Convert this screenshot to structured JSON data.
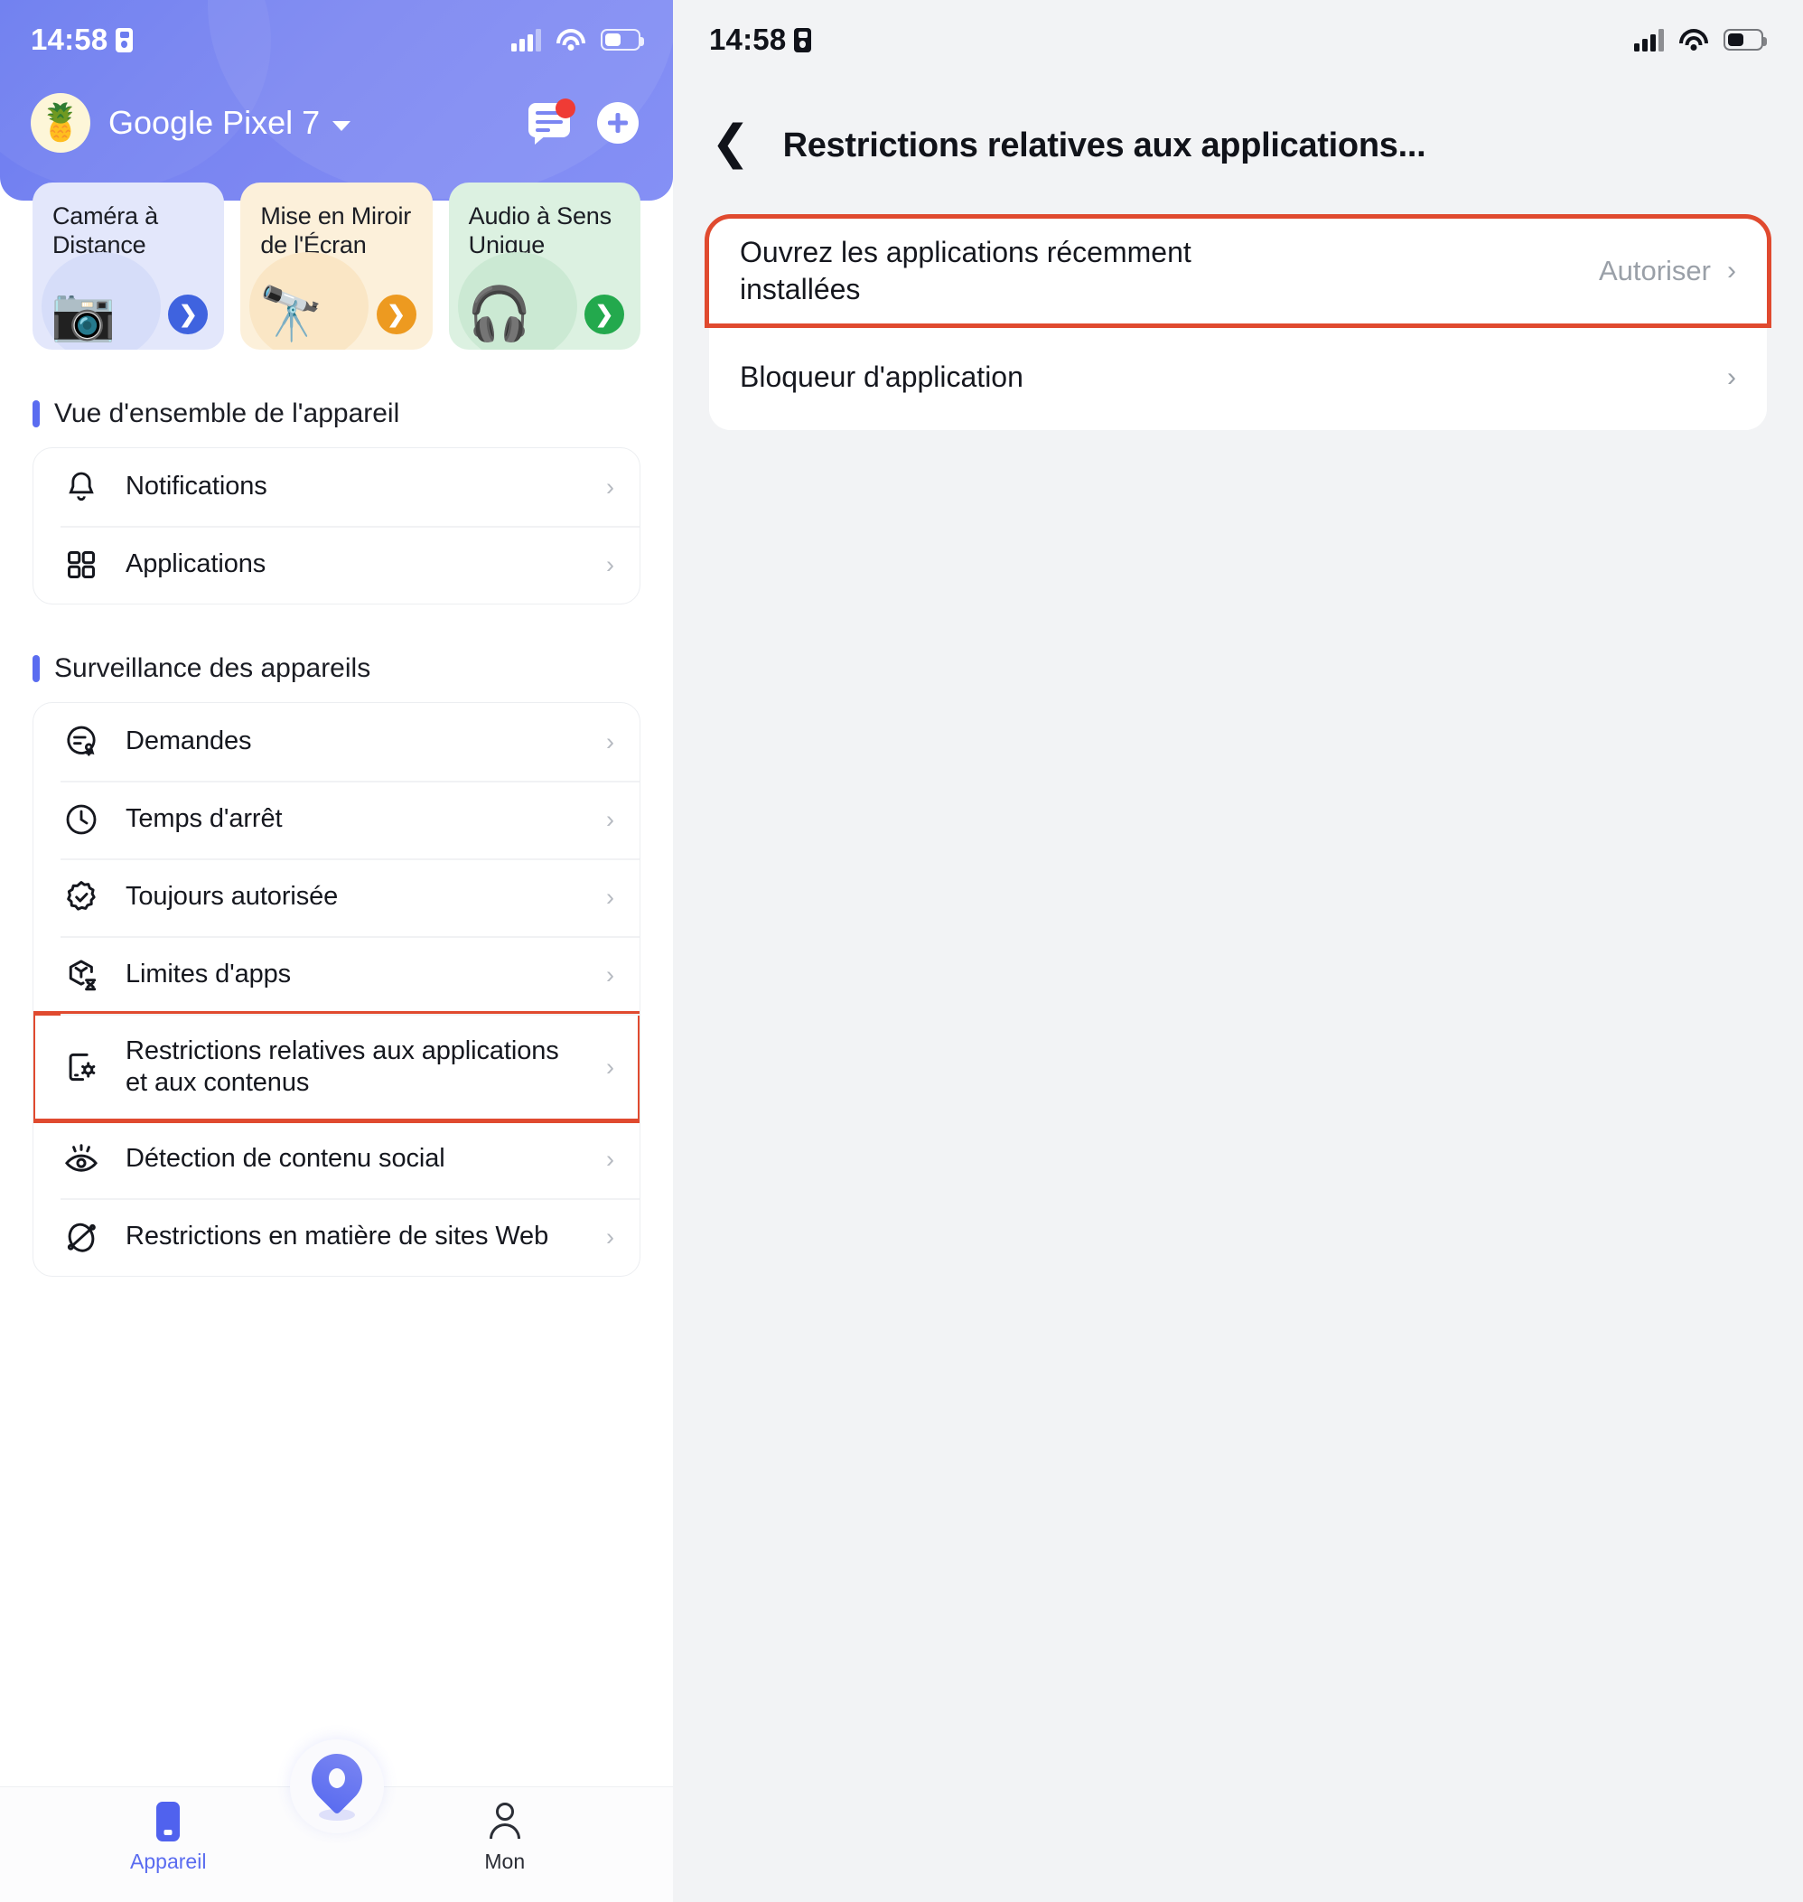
{
  "left": {
    "status": {
      "time": "14:58",
      "sim_icon": "sim-card-icon"
    },
    "header": {
      "avatar_emoji": "🍍",
      "device_name": "Google Pixel 7",
      "dropdown_icon": "caret-down-icon",
      "chat_icon": "message-icon",
      "add_icon": "plus-icon"
    },
    "feature_cards": [
      {
        "title": "Caméra à Distance",
        "glyph": "📷",
        "bg": "#e3e7fb",
        "blob": "#d6ddf9",
        "arrow_color": "#3f63df"
      },
      {
        "title": "Mise en Miroir de l'Écran",
        "glyph": "🔭",
        "bg": "#fcf0da",
        "blob": "#fae6c5",
        "arrow_color": "#ed9a20"
      },
      {
        "title": "Audio à Sens Unique",
        "glyph": "🎧",
        "bg": "#dcf1e1",
        "blob": "#cbe9d3",
        "arrow_color": "#23a94d"
      }
    ],
    "sections": [
      {
        "title": "Vue d'ensemble de l'appareil",
        "items": [
          {
            "label": "Notifications",
            "icon": "bell-icon",
            "chevron": "›"
          },
          {
            "label": "Applications",
            "icon": "grid-apps-icon",
            "chevron": "›"
          }
        ]
      },
      {
        "title": "Surveillance des appareils",
        "items": [
          {
            "label": "Demandes",
            "icon": "request-message-icon",
            "chevron": "›"
          },
          {
            "label": "Temps d'arrêt",
            "icon": "clock-icon",
            "chevron": "›"
          },
          {
            "label": "Toujours autorisée",
            "icon": "badge-check-icon",
            "chevron": "›"
          },
          {
            "label": "Limites d'apps",
            "icon": "hourglass-limit-icon",
            "chevron": "›"
          },
          {
            "label": "Restrictions relatives aux applications et aux contenus",
            "icon": "device-settings-icon",
            "chevron": "›",
            "highlighted": true
          },
          {
            "label": "Détection de contenu social",
            "icon": "eye-detect-icon",
            "chevron": "›"
          },
          {
            "label": "Restrictions en matière de sites Web",
            "icon": "globe-blocked-icon",
            "chevron": "›"
          }
        ]
      }
    ],
    "bottom_nav": {
      "fab_icon": "location-pin-icon",
      "tabs": [
        {
          "label": "Appareil",
          "icon": "phone-icon",
          "active": true
        },
        {
          "label": "Mon",
          "icon": "person-icon",
          "active": false
        }
      ]
    }
  },
  "right": {
    "status": {
      "time": "14:58",
      "sim_icon": "sim-card-icon"
    },
    "header": {
      "back_icon": "back-chevron-icon",
      "title": "Restrictions relatives aux applications..."
    },
    "items": [
      {
        "label": "Ouvrez les applications récemment installées",
        "value": "Autoriser",
        "chevron": "›",
        "highlighted": true
      },
      {
        "label": "Bloqueur d'application",
        "value": "",
        "chevron": "›",
        "highlighted": false
      }
    ]
  },
  "colors": {
    "accent_blue": "#5a6cf0",
    "highlight_red": "#e04a2f",
    "muted_text": "#9aa0a8",
    "page_bg": "#f2f3f5"
  }
}
